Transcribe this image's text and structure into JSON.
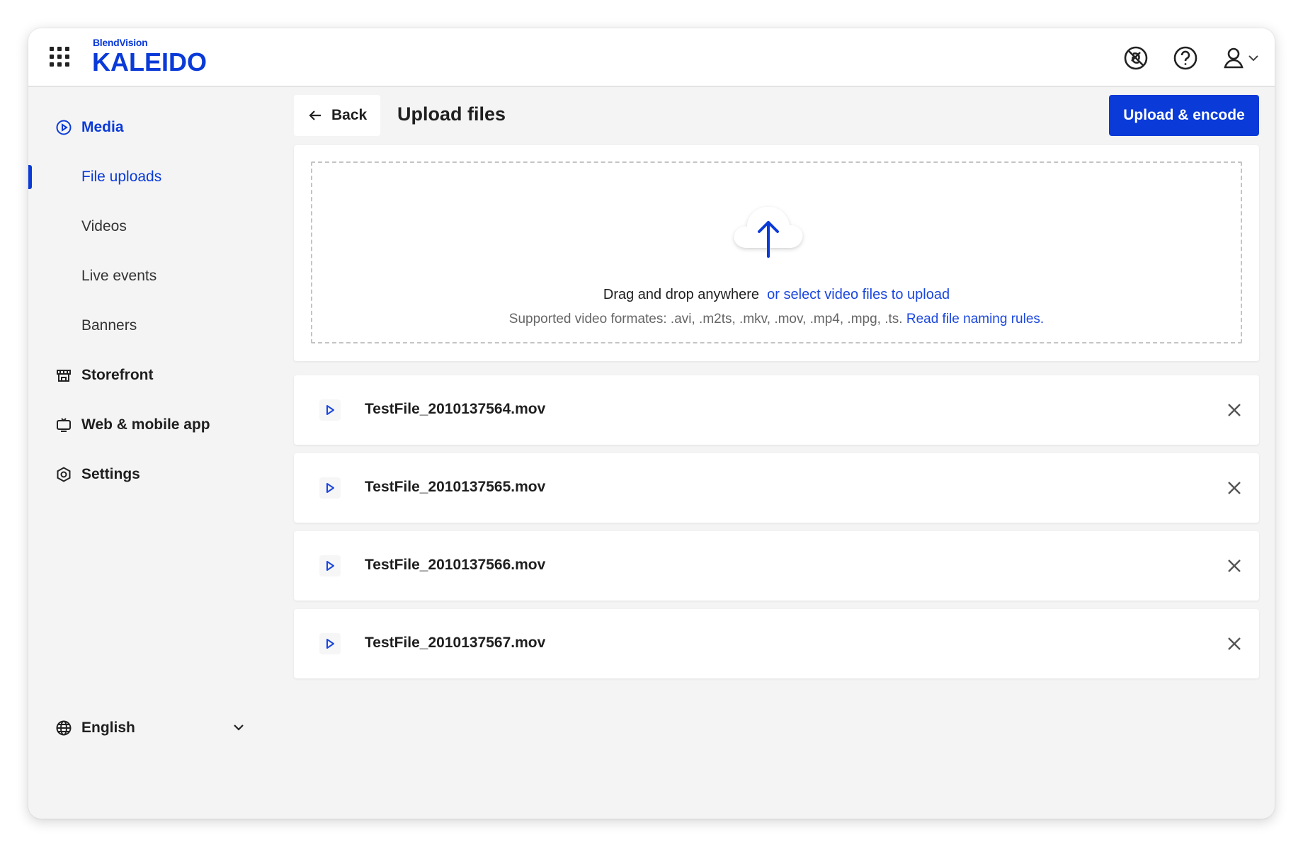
{
  "header": {
    "brand_small": "BlendVision",
    "brand_name": "KALEIDO",
    "icons": [
      "apps-grid-icon",
      "no-tracking-icon",
      "help-icon",
      "user-icon",
      "chevron-down-icon"
    ]
  },
  "sidebar": {
    "items": [
      {
        "label": "Media",
        "icon": "play-circle-icon",
        "level": "top",
        "active": true
      },
      {
        "label": "File uploads",
        "level": "sub",
        "active": true
      },
      {
        "label": "Videos",
        "level": "sub"
      },
      {
        "label": "Live events",
        "level": "sub"
      },
      {
        "label": "Banners",
        "level": "sub"
      },
      {
        "label": "Storefront",
        "icon": "storefront-icon",
        "level": "top"
      },
      {
        "label": "Web & mobile app",
        "icon": "tv-icon",
        "level": "top"
      },
      {
        "label": "Settings",
        "icon": "gear-icon",
        "level": "top"
      }
    ],
    "language": "English"
  },
  "main": {
    "back_label": "Back",
    "title": "Upload files",
    "primary_label": "Upload & encode",
    "dropzone": {
      "prefix": "Drag and drop anywhere",
      "select_link": "or select video files to upload",
      "formats": "Supported video formates: .avi, .m2ts, .mkv, .mov, .mp4, .mpg, .ts.",
      "rules_link": "Read file naming rules."
    },
    "files": [
      {
        "name": "TestFile_2010137564.mov"
      },
      {
        "name": "TestFile_2010137565.mov"
      },
      {
        "name": "TestFile_2010137566.mov"
      },
      {
        "name": "TestFile_2010137567.mov"
      }
    ]
  },
  "colors": {
    "accent": "#0a3ad8",
    "link": "#1a46e0",
    "background": "#f4f4f4"
  }
}
